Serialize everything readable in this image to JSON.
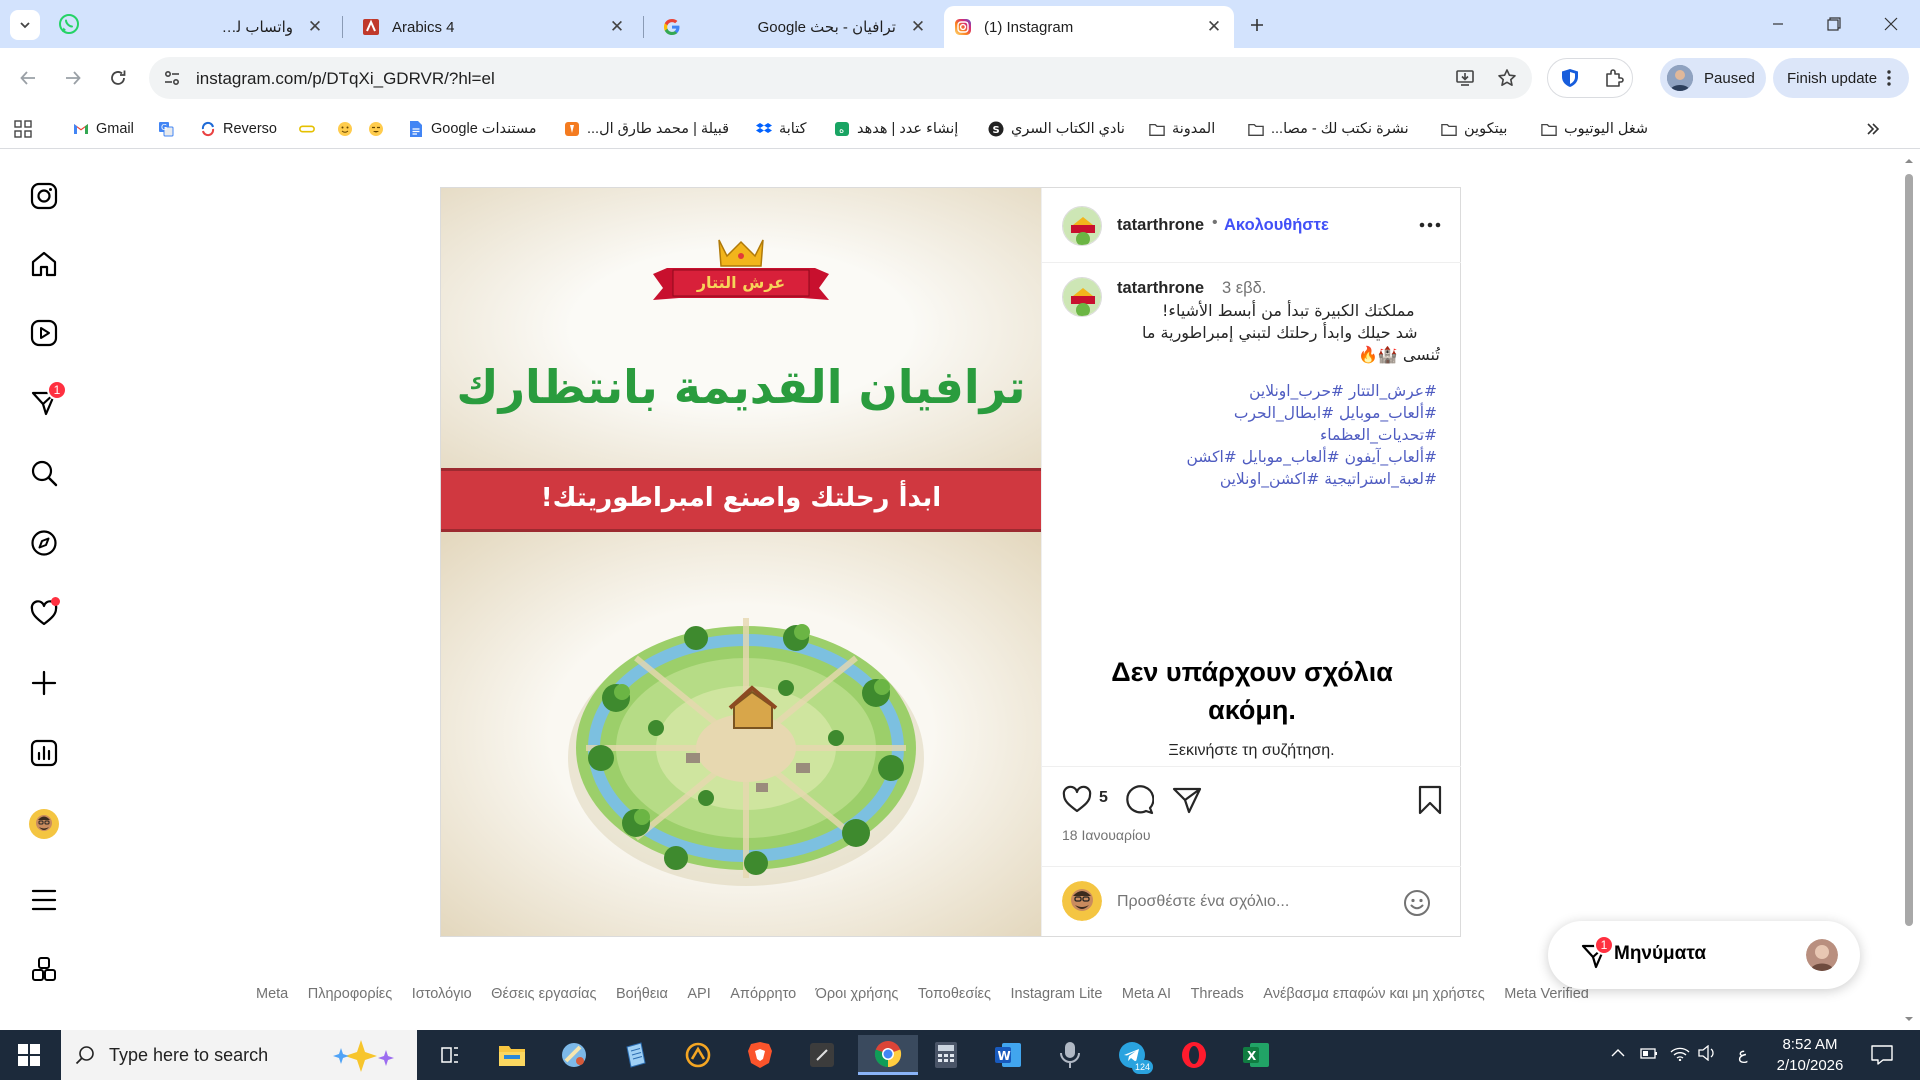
{
  "tabs": [
    {
      "title": "واتساب للأعمال",
      "icon": "whatsapp-icon",
      "active": false
    },
    {
      "title": "Arabics 4",
      "icon": "arabics-icon",
      "active": false
    },
    {
      "title": "ترافيان - بحث Google",
      "icon": "google-icon",
      "active": false
    },
    {
      "title": "(1) Instagram",
      "icon": "instagram-icon",
      "active": true
    }
  ],
  "toolbar": {
    "url": "instagram.com/p/DTqXi_GDRVR/?hl=el",
    "profile_status": "Paused",
    "update_label": "Finish update"
  },
  "bookmarks": [
    {
      "label": "Gmail",
      "icon": "gmail-icon"
    },
    {
      "label": "",
      "icon": "translate-icon"
    },
    {
      "label": "Reverso",
      "icon": "reverso-icon"
    },
    {
      "label": "",
      "icon": "link-icon"
    },
    {
      "label": "",
      "icon": "emoji-icon"
    },
    {
      "label": "",
      "icon": "emoji-icon"
    },
    {
      "label": "مستندات Google",
      "icon": "docs-icon"
    },
    {
      "label": "قبيلة | محمد طارق ال...",
      "icon": "site-icon"
    },
    {
      "label": "كتابة",
      "icon": "dropbox-icon"
    },
    {
      "label": "إنشاء عدد | هدهد",
      "icon": "site-icon"
    },
    {
      "label": "نادي الكتاب السري",
      "icon": "site-icon"
    },
    {
      "label": "المدونة",
      "icon": "folder-icon"
    },
    {
      "label": "نشرة نكتب لك - مصا...",
      "icon": "folder-icon"
    },
    {
      "label": "بيتكوين",
      "icon": "folder-icon"
    },
    {
      "label": "شغل اليوتيوب",
      "icon": "folder-icon"
    }
  ],
  "sidebar": {
    "items": [
      {
        "name": "instagram-logo-icon"
      },
      {
        "name": "home-icon"
      },
      {
        "name": "reels-icon"
      },
      {
        "name": "messages-icon",
        "badge": "1"
      },
      {
        "name": "search-icon"
      },
      {
        "name": "explore-icon"
      },
      {
        "name": "notifications-icon"
      },
      {
        "name": "create-icon"
      },
      {
        "name": "dashboard-icon"
      },
      {
        "name": "profile-avatar"
      },
      {
        "name": "menu-icon"
      },
      {
        "name": "more-apps-icon"
      }
    ]
  },
  "post": {
    "image": {
      "logo_text": "عرش التتار",
      "headline": "ترافيان القديمة بانتظارك",
      "banner": "ابدأ رحلتك واصنع امبراطوريتك!"
    },
    "username": "tatarthrone",
    "follow_label": "Ακολουθήστε",
    "caption": {
      "username": "tatarthrone",
      "time": "3 εβδ.",
      "lines": [
        "مملكتك الكبيرة تبدأ من أبسط الأشياء!",
        "شد حيلك وابدأ رحلتك لتبني إمبراطورية ما",
        "تُنسى 🏰🔥"
      ],
      "hashtags": [
        "#عرش_التتار #حرب_اونلاين",
        "#ألعاب_موبايل #ابطال_الحرب",
        "#تحديات_العظماء",
        "#ألعاب_آيفون #ألعاب_موبايل #اكشن",
        "#لعبة_استراتيجية #اكشن_اونلاين"
      ]
    },
    "no_comments_title": "Δεν υπάρχουν σχόλια ακόμη.",
    "no_comments_sub": "Ξεκινήστε τη συζήτηση.",
    "likes": "5",
    "date": "18 Ιανουαρίου",
    "comment_placeholder": "Προσθέστε ένα σχόλιο..."
  },
  "footer_links": [
    "Meta",
    "Πληροφορίες",
    "Ιστολόγιο",
    "Θέσεις εργασίας",
    "Βοήθεια",
    "API",
    "Απόρρητο",
    "Όροι χρήσης",
    "Τοποθεσίες",
    "Instagram Lite",
    "Meta AI",
    "Threads",
    "Ανέβασμα επαφών και μη χρήστες",
    "Meta Verified"
  ],
  "messages_pill": {
    "label": "Μηνύματα",
    "badge": "1"
  },
  "taskbar": {
    "search_placeholder": "Type here to search",
    "telegram_badge": "124",
    "lang": "ع",
    "time": "8:52 AM",
    "date": "2/10/2026"
  },
  "colors": {
    "instagram_blue": "#4150f7",
    "hashtag_blue": "#4f5cc1",
    "badge_red": "#ff3040",
    "chrome_tab_strip": "#d3e3fd"
  }
}
